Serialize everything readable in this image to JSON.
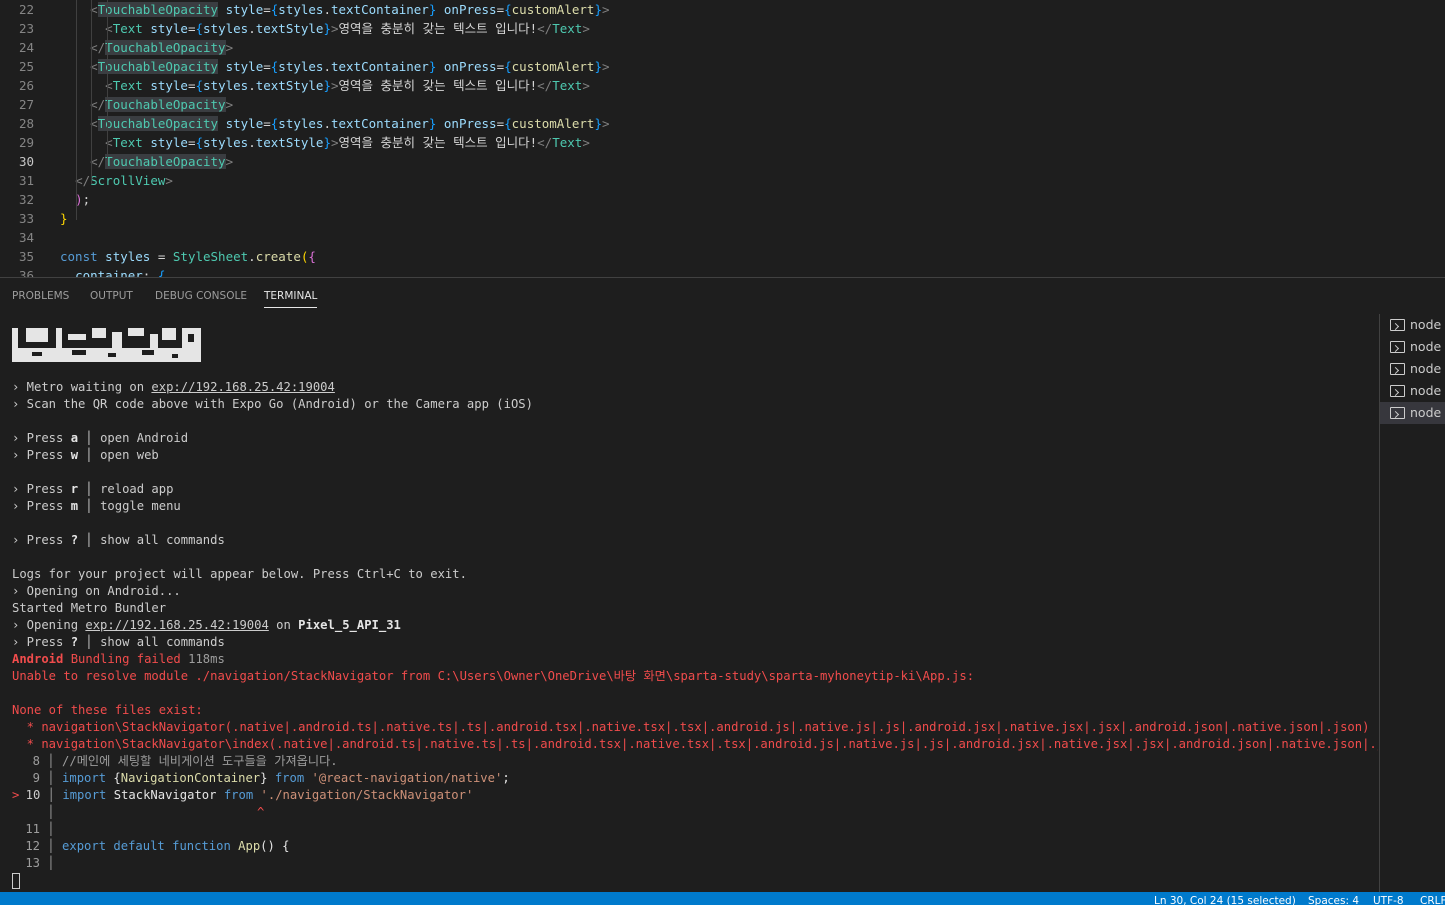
{
  "editor": {
    "lines": [
      {
        "num": "22",
        "active": false,
        "indent": 2,
        "kind": "open"
      },
      {
        "num": "23",
        "active": false,
        "indent": 3,
        "kind": "text"
      },
      {
        "num": "24",
        "active": false,
        "indent": 2,
        "kind": "close"
      },
      {
        "num": "25",
        "active": false,
        "indent": 2,
        "kind": "open"
      },
      {
        "num": "26",
        "active": false,
        "indent": 3,
        "kind": "text"
      },
      {
        "num": "27",
        "active": false,
        "indent": 2,
        "kind": "close"
      },
      {
        "num": "28",
        "active": false,
        "indent": 2,
        "kind": "open"
      },
      {
        "num": "29",
        "active": false,
        "indent": 3,
        "kind": "text"
      },
      {
        "num": "30",
        "active": true,
        "indent": 2,
        "kind": "close"
      },
      {
        "num": "31",
        "active": false,
        "indent": 1,
        "kind": "scrollclose"
      },
      {
        "num": "32",
        "active": false,
        "indent": 0,
        "kind": "paren"
      },
      {
        "num": "33",
        "active": false,
        "indent": 0,
        "kind": "brace"
      },
      {
        "num": "34",
        "active": false,
        "indent": 0,
        "kind": "empty"
      },
      {
        "num": "35",
        "active": false,
        "indent": 0,
        "kind": "styles"
      },
      {
        "num": "36",
        "active": false,
        "indent": 0,
        "kind": "container"
      }
    ],
    "tokens": {
      "touchable": "TouchableOpacity",
      "style_attr": "style",
      "styles": "styles",
      "text_container": "textContainer",
      "on_press": "onPress",
      "custom_alert": "customAlert",
      "text_tag": "Text",
      "text_style": "textStyle",
      "korean_text": "영역을 충분히 갖는 텍스트 입니다!",
      "scroll_view": "ScrollView",
      "const_kw": "const",
      "stylesheet": "StyleSheet",
      "create": "create",
      "container_key": "container"
    }
  },
  "panel": {
    "tabs": [
      {
        "label": "PROBLEMS",
        "active": false
      },
      {
        "label": "OUTPUT",
        "active": false
      },
      {
        "label": "DEBUG CONSOLE",
        "active": false
      },
      {
        "label": "TERMINAL",
        "active": true
      }
    ],
    "terminal_list": [
      {
        "label": "node",
        "selected": false
      },
      {
        "label": "node",
        "selected": false
      },
      {
        "label": "node",
        "selected": false
      },
      {
        "label": "node",
        "selected": false
      },
      {
        "label": "node",
        "selected": true
      }
    ]
  },
  "terminal": {
    "metro_waiting_prefix": "› Metro waiting on ",
    "metro_url": "exp://192.168.25.42:19004",
    "scan_qr": "› Scan the QR code above with Expo Go (Android) or the Camera app (iOS)",
    "press_prefix": "› Press ",
    "keys": [
      {
        "key": "a",
        "desc": "open Android"
      },
      {
        "key": "w",
        "desc": "open web"
      },
      {
        "key": "r",
        "desc": "reload app"
      },
      {
        "key": "m",
        "desc": "toggle menu"
      },
      {
        "key": "?",
        "desc": "show all commands"
      }
    ],
    "logs_line": "Logs for your project will appear below. Press Ctrl+C to exit.",
    "opening_android": "› Opening on Android...",
    "started_metro": "Started Metro Bundler",
    "opening_prefix": "› Opening ",
    "opening_url": "exp://192.168.25.42:19004",
    "opening_on": " on ",
    "device": "Pixel_5_API_31",
    "press_q_key": "?",
    "press_q_desc": "show all commands",
    "bundling_android": "Android",
    "bundling_failed": " Bundling failed ",
    "bundling_time": "118ms",
    "unable_resolve": "Unable to resolve module ./navigation/StackNavigator from C:\\Users\\Owner\\OneDrive\\바탕 화면\\sparta-study\\sparta-myhoneytip-ki\\App.js:",
    "none_exist": "None of these files exist:",
    "missing_files": [
      "  * navigation\\StackNavigator(.native|.android.ts|.native.ts|.ts|.android.tsx|.native.tsx|.tsx|.android.js|.native.js|.js|.android.jsx|.native.jsx|.jsx|.android.json|.native.json|.json)",
      "  * navigation\\StackNavigator\\index(.native|.android.ts|.native.ts|.ts|.android.tsx|.native.tsx|.tsx|.android.js|.native.js|.js|.android.jsx|.native.jsx|.jsx|.android.json|.native.json|.json)"
    ],
    "frame": {
      "l8_num": "8",
      "l8_code": "//메인에 세팅할 네비게이션 도구들을 가져옵니다.",
      "l9_num": "9",
      "l9_import": "import",
      "l9_obrace": "{",
      "l9_name": "NavigationContainer",
      "l9_cbrace": "}",
      "l9_from": "from",
      "l9_str": "'@react-navigation/native'",
      "l9_semi": ";",
      "l10_marker": ">",
      "l10_num": "10",
      "l10_import": "import",
      "l10_name": "StackNavigator",
      "l10_from": "from",
      "l10_str": "'./navigation/StackNavigator'",
      "caret": "^",
      "l11_num": "11",
      "l12_num": "12",
      "l12_export": "export",
      "l12_default": "default",
      "l12_function": "function",
      "l12_name": "App",
      "l12_rest": "() {",
      "l13_num": "13"
    }
  },
  "statusbar": {
    "position": "Ln 30, Col 24 (15 selected)",
    "spaces": "Spaces: 4",
    "encoding": "UTF-8",
    "eol": "CRLF"
  },
  "colors": {
    "background": "#1e1e1e",
    "statusbar": "#007acc",
    "error": "#f14c4c",
    "tag": "#4ec9b0",
    "attribute": "#9cdcfe"
  }
}
